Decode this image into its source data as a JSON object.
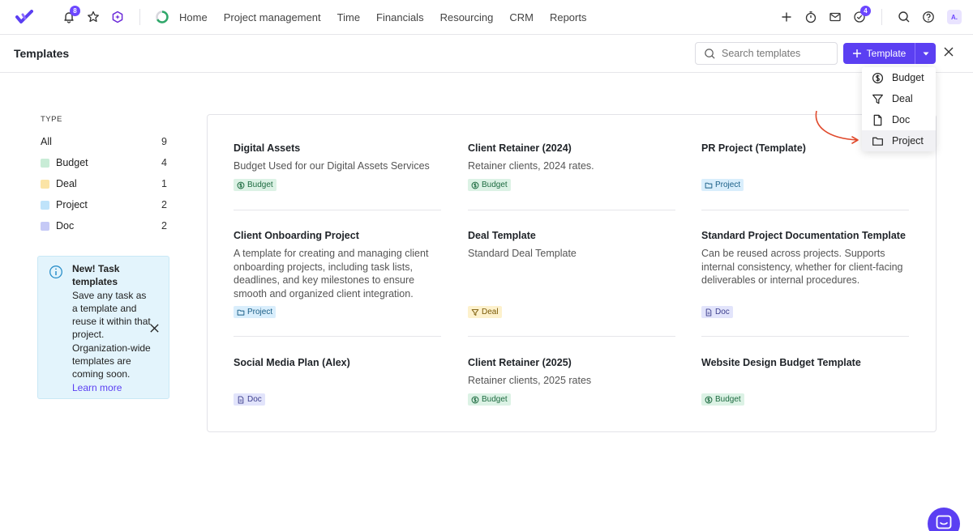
{
  "nav": {
    "notifications_badge": "8",
    "inbox_badge": "4",
    "links": [
      "Home",
      "Project management",
      "Time",
      "Financials",
      "Resourcing",
      "CRM",
      "Reports"
    ],
    "avatar_initials": "A."
  },
  "header": {
    "title": "Templates",
    "search_placeholder": "Search templates",
    "template_button_label": "Template"
  },
  "dropdown": {
    "items": [
      {
        "label": "Budget",
        "icon": "dollar-circle-icon"
      },
      {
        "label": "Deal",
        "icon": "funnel-icon"
      },
      {
        "label": "Doc",
        "icon": "document-icon"
      },
      {
        "label": "Project",
        "icon": "folder-icon"
      }
    ]
  },
  "sidebar": {
    "heading": "TYPE",
    "types": [
      {
        "label": "All",
        "count": "9",
        "color": ""
      },
      {
        "label": "Budget",
        "count": "4",
        "color": "#c8ecd6"
      },
      {
        "label": "Deal",
        "count": "1",
        "color": "#fbe4a6"
      },
      {
        "label": "Project",
        "count": "2",
        "color": "#bfe3fa"
      },
      {
        "label": "Doc",
        "count": "2",
        "color": "#c5c9f6"
      }
    ],
    "info": {
      "title": "New! Task templates",
      "body": "Save any task as a template and reuse it within that project. Organization-wide templates are coming soon.",
      "link": "Learn more"
    }
  },
  "templates": [
    {
      "title": "Digital Assets",
      "desc": "Budget Used for our Digital Assets Services",
      "tag": "Budget"
    },
    {
      "title": "Client Retainer (2024)",
      "desc": "Retainer clients, 2024 rates.",
      "tag": "Budget"
    },
    {
      "title": "PR Project (Template)",
      "desc": "",
      "tag": "Project"
    },
    {
      "title": "Client Onboarding Project",
      "desc": "A template for creating and managing client onboarding projects, including task lists, deadlines, and key milestones to ensure smooth and organized client integration.",
      "tag": "Project"
    },
    {
      "title": "Deal Template",
      "desc": "Standard Deal Template",
      "tag": "Deal"
    },
    {
      "title": "Standard Project Documentation Template",
      "desc": "Can be reused across projects. Supports internal consistency, whether for client-facing deliverables or internal procedures.",
      "tag": "Doc"
    },
    {
      "title": "Social Media Plan (Alex)",
      "desc": "",
      "tag": "Doc"
    },
    {
      "title": "Client Retainer (2025)",
      "desc": "Retainer clients, 2025 rates",
      "tag": "Budget"
    },
    {
      "title": "Website Design Budget Template",
      "desc": "",
      "tag": "Budget"
    }
  ],
  "colors": {
    "accent": "#5b3ff2",
    "annotation_arrow": "#e0492b"
  }
}
